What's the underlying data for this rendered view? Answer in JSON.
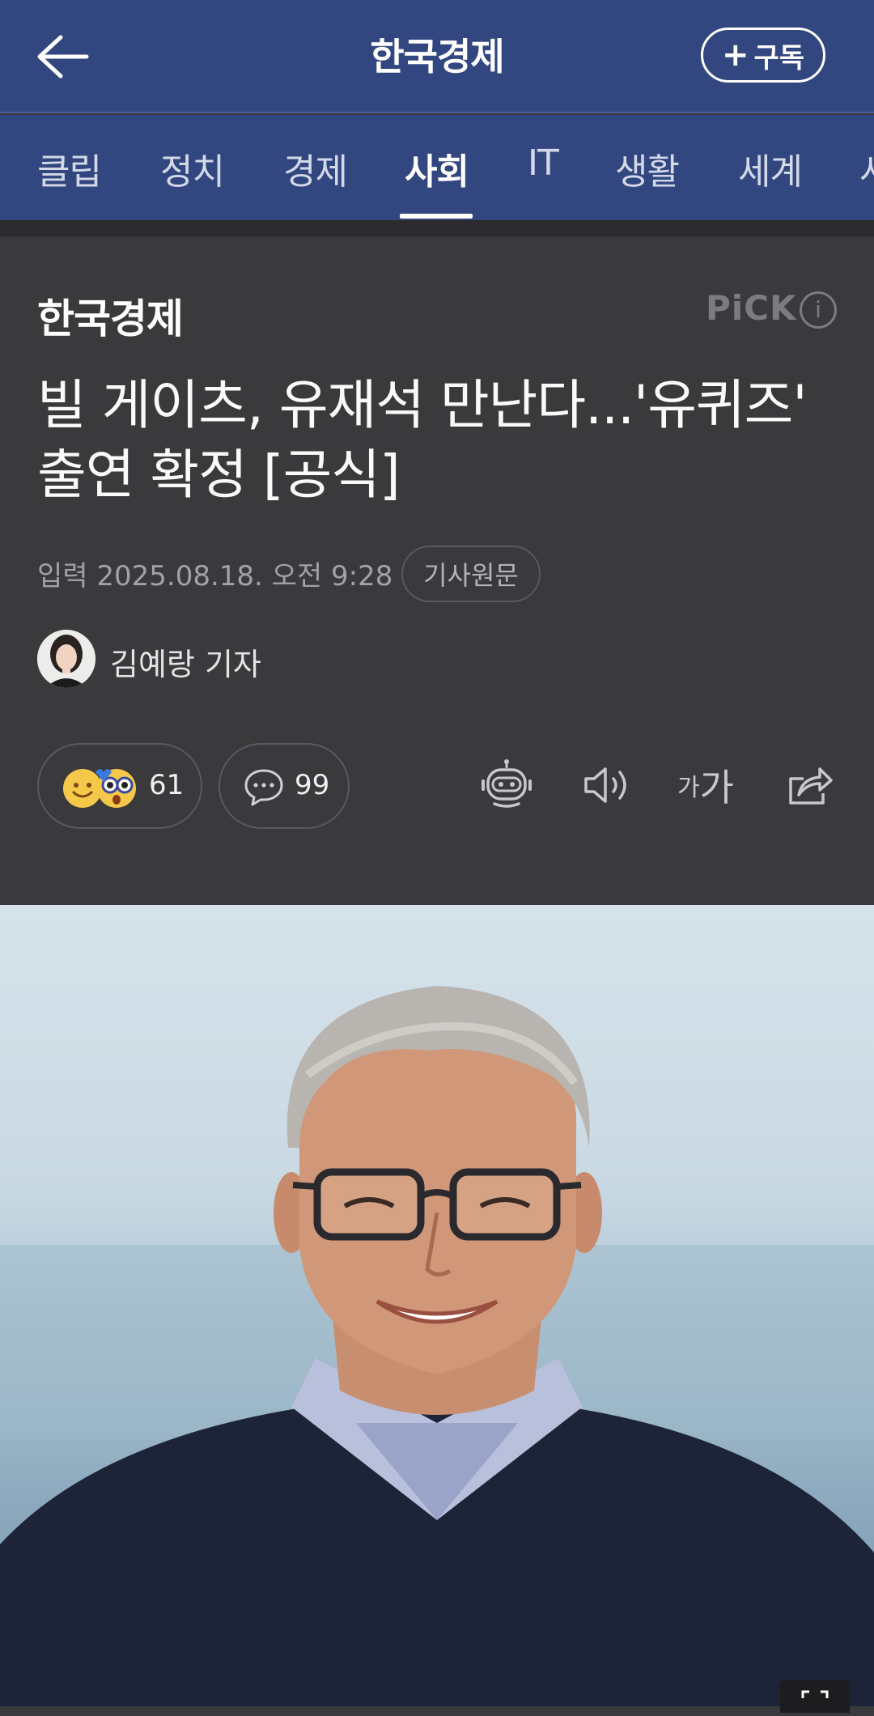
{
  "header": {
    "press_name": "한국경제",
    "subscribe_label": "구독"
  },
  "tabs": [
    {
      "label": "클립",
      "active": false
    },
    {
      "label": "정치",
      "active": false
    },
    {
      "label": "경제",
      "active": false
    },
    {
      "label": "사회",
      "active": true
    },
    {
      "label": "IT",
      "active": false
    },
    {
      "label": "생활",
      "active": false
    },
    {
      "label": "세계",
      "active": false
    },
    {
      "label": "사",
      "active": false
    }
  ],
  "article": {
    "press_logo": "한국경제",
    "pick_label": "PiCK",
    "pick_info": "i",
    "headline": "빌 게이츠, 유재석 만난다...'유퀴즈' 출연 확정 [공식]",
    "dateline": "입력 2025.08.18. 오전 9:28",
    "original_label": "기사원문",
    "reporter": "김예랑 기자",
    "reaction_count": "61",
    "comment_count": "99",
    "font_small": "가",
    "font_large": "가"
  },
  "colors": {
    "header_bg": "#324680",
    "article_bg": "#3a3a3c"
  }
}
